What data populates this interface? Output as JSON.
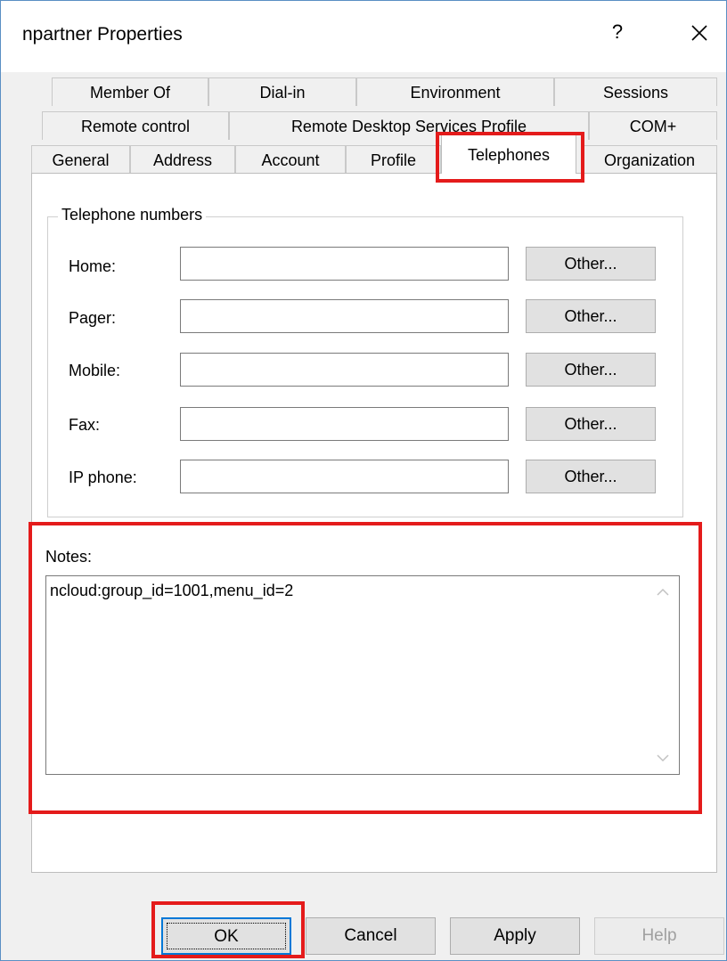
{
  "window": {
    "title": "npartner Properties",
    "help_glyph": "?"
  },
  "tabs": {
    "row1": [
      "Member Of",
      "Dial-in",
      "Environment",
      "Sessions"
    ],
    "row2": [
      "Remote control",
      "Remote Desktop Services Profile",
      "COM+"
    ],
    "row3": [
      "General",
      "Address",
      "Account",
      "Profile",
      "Telephones",
      "Organization"
    ],
    "active": "Telephones"
  },
  "telephone_group": {
    "title": "Telephone numbers",
    "fields": [
      {
        "label": "Home:",
        "value": "",
        "button": "Other..."
      },
      {
        "label": "Pager:",
        "value": "",
        "button": "Other..."
      },
      {
        "label": "Mobile:",
        "value": "",
        "button": "Other..."
      },
      {
        "label": "Fax:",
        "value": "",
        "button": "Other..."
      },
      {
        "label": "IP phone:",
        "value": "",
        "button": "Other..."
      }
    ]
  },
  "notes": {
    "label": "Notes:",
    "value": "ncloud:group_id=1001,menu_id=2"
  },
  "buttons": {
    "ok": "OK",
    "cancel": "Cancel",
    "apply": "Apply",
    "help": "Help"
  },
  "colors": {
    "highlight": "#e41b1b",
    "default_button_border": "#0078d7"
  }
}
